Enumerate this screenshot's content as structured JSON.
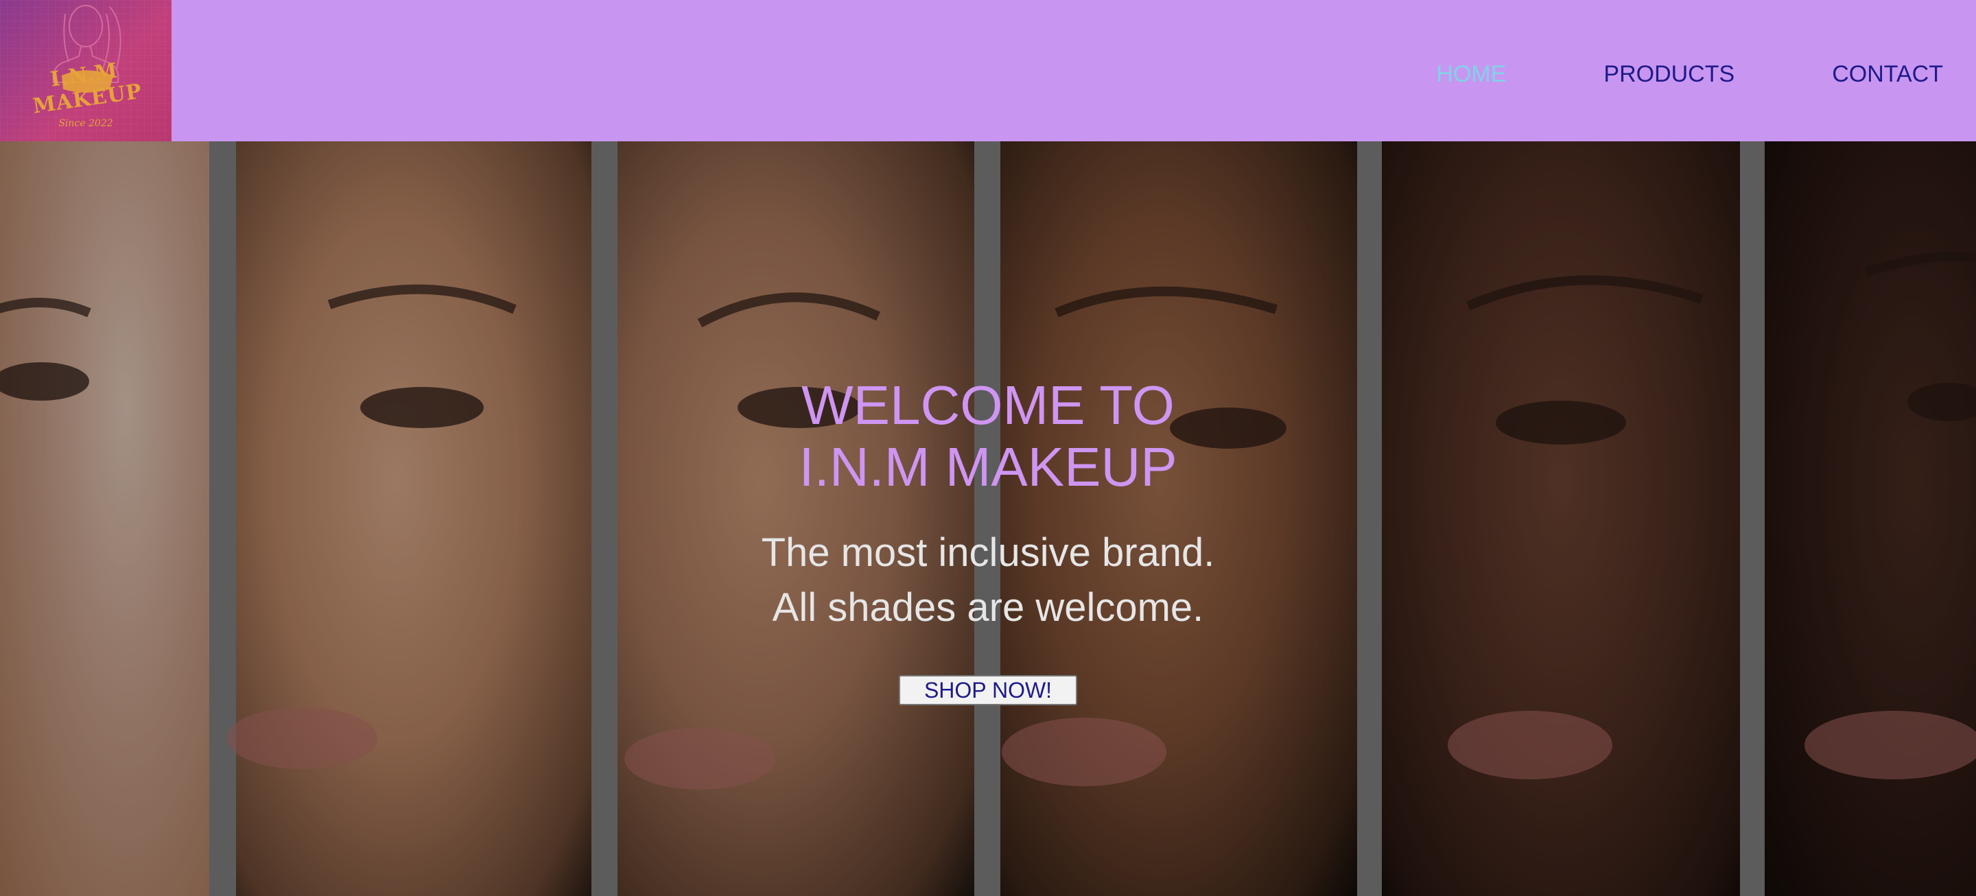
{
  "header": {
    "logo": {
      "brand_text": "I.N.M MAKEUP",
      "since_text": "Since 2022"
    },
    "nav": {
      "home": "HOME",
      "products": "PRODUCTS",
      "contact": "CONTACT"
    },
    "colors": {
      "background": "#c896f0",
      "nav_text": "#1f1a8a",
      "nav_active": "#7fd3e8"
    }
  },
  "hero": {
    "title_line1": "WELCOME TO",
    "title_line2": "I.N.M MAKEUP",
    "subtitle_line1": "The most inclusive brand.",
    "subtitle_line2": "All shades are welcome.",
    "cta_label": "SHOP NOW!",
    "colors": {
      "title": "#cf95f2",
      "subtitle": "#e6e6e6"
    }
  }
}
